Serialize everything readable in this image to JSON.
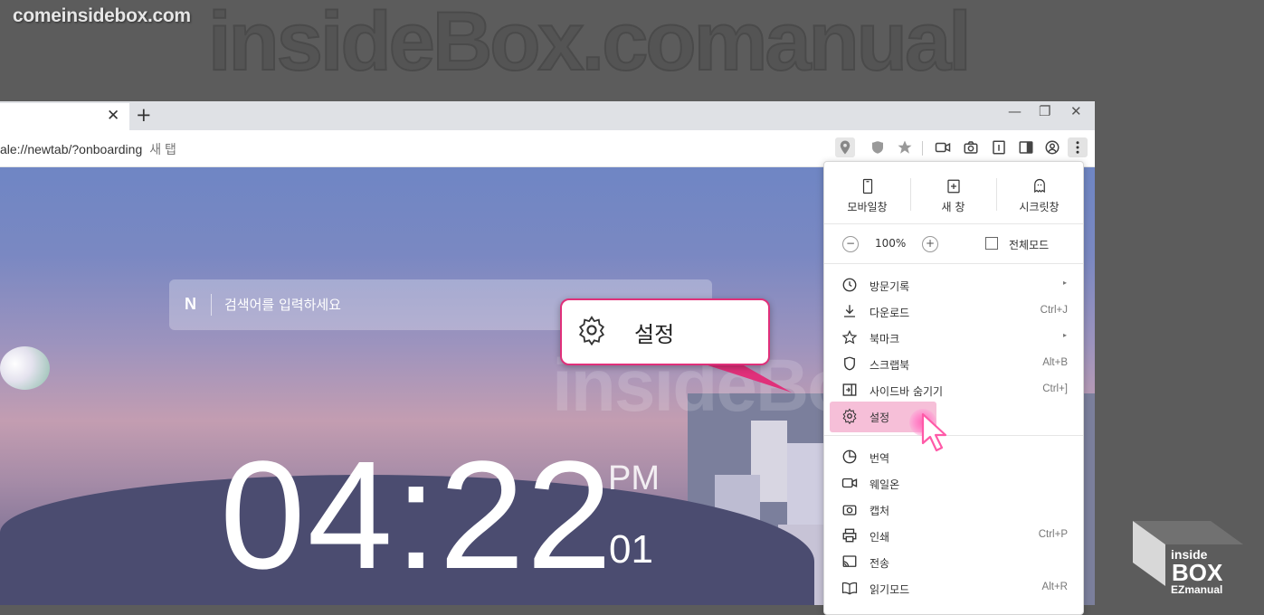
{
  "site_label": "comeinsidebox.com",
  "bg_watermark": "insideBox.comanual",
  "browser": {
    "tab_close": "✕",
    "new_tab": "+",
    "window_controls": [
      "—",
      "❐",
      "✕"
    ],
    "url": "ale://newtab/?onboarding",
    "page_title": "새 탭",
    "toolbar_icons": [
      "location-pin-icon",
      "shield-icon",
      "star-icon",
      "camera-record-icon",
      "capture-icon",
      "reader-icon",
      "sidebar-icon",
      "profile-icon",
      "more-menu-icon"
    ]
  },
  "newtab": {
    "search_logo": "N",
    "search_placeholder": "검색어를 입력하세요",
    "clock_time": "04:22",
    "ampm": "PM",
    "seconds": "01",
    "watermark": "insideBox.com"
  },
  "menu": {
    "top_items": [
      {
        "label": "모바일창",
        "icon": "mobile-window-icon"
      },
      {
        "label": "새 창",
        "icon": "new-window-icon"
      },
      {
        "label": "시크릿창",
        "icon": "secret-window-icon"
      }
    ],
    "zoom": {
      "minus": "−",
      "value": "100%",
      "plus": "+",
      "fullscreen_label": "전체모드"
    },
    "items": [
      {
        "label": "방문기록",
        "shortcut": "",
        "arrow": "▸",
        "icon": "history-icon"
      },
      {
        "label": "다운로드",
        "shortcut": "Ctrl+J",
        "arrow": "",
        "icon": "download-icon"
      },
      {
        "label": "북마크",
        "shortcut": "",
        "arrow": "▸",
        "icon": "bookmark-star-icon"
      },
      {
        "label": "스크랩북",
        "shortcut": "Alt+B",
        "arrow": "",
        "icon": "scrapbook-icon"
      },
      {
        "label": "사이드바 숨기기",
        "shortcut": "Ctrl+]",
        "arrow": "",
        "icon": "sidebar-hide-icon"
      },
      {
        "label": "설정",
        "shortcut": "",
        "arrow": "",
        "icon": "settings-gear-icon"
      },
      {
        "label": "번역",
        "shortcut": "",
        "arrow": "",
        "icon": "translate-icon"
      },
      {
        "label": "웨일온",
        "shortcut": "",
        "arrow": "",
        "icon": "whale-on-icon"
      },
      {
        "label": "캡처",
        "shortcut": "",
        "arrow": "",
        "icon": "capture-icon"
      },
      {
        "label": "인쇄",
        "shortcut": "Ctrl+P",
        "arrow": "",
        "icon": "print-icon"
      },
      {
        "label": "전송",
        "shortcut": "",
        "arrow": "",
        "icon": "cast-icon"
      },
      {
        "label": "읽기모드",
        "shortcut": "Alt+R",
        "arrow": "",
        "icon": "reading-mode-icon"
      }
    ],
    "highlighted_item": "설정"
  },
  "callout": {
    "label": "설정",
    "icon": "settings-gear-icon",
    "color": "#e0307a"
  },
  "brand_logo": {
    "line1": "inside",
    "line2": "BOX",
    "line3": "EZmanual"
  }
}
